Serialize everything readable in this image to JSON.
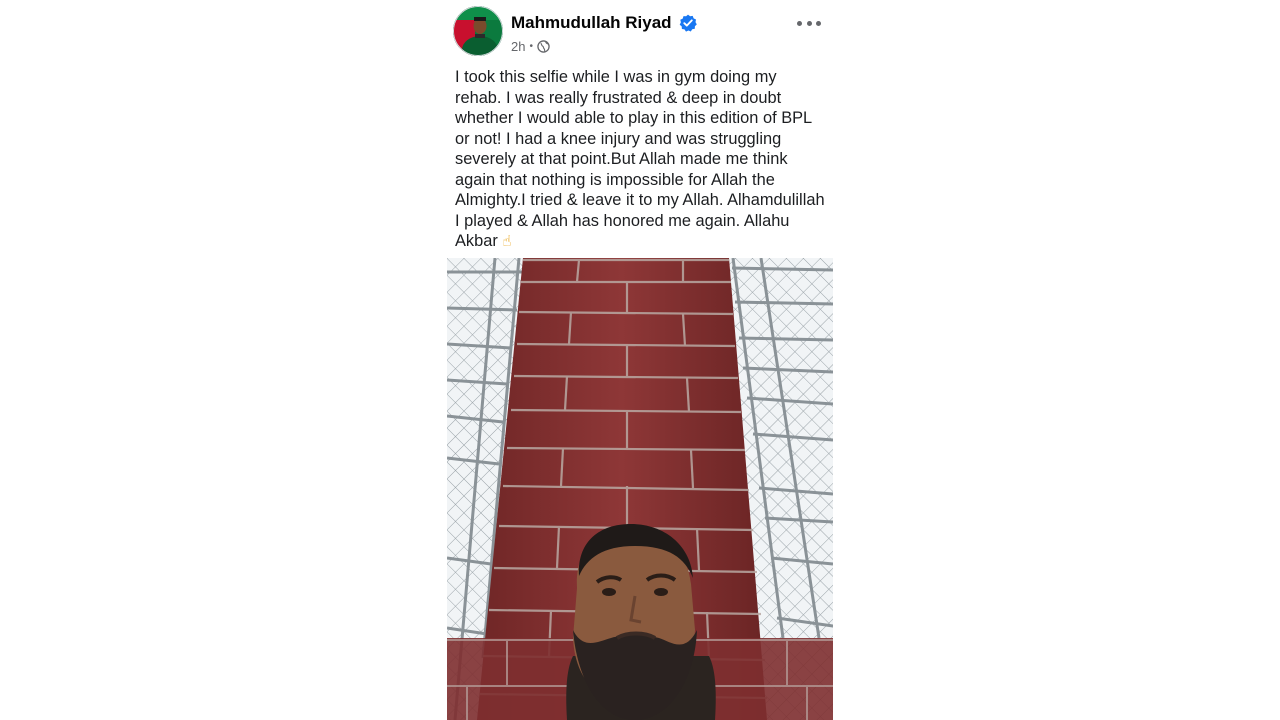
{
  "post": {
    "author": {
      "name": "Mahmudullah Riyad",
      "verified": true,
      "avatar_icon": "profile-photo"
    },
    "meta": {
      "time": "2h",
      "separator": "•",
      "privacy_icon": "globe-icon"
    },
    "menu_icon": "more-horizontal-icon",
    "text": "I took this selfie while I was in gym doing my rehab. I was really frustrated & deep in doubt whether I would able to play in this edition of BPL or not! I had a knee injury and was struggling severely at that point.But Allah made me think again that nothing is impossible for Allah the Almighty.I tried & leave it to my Allah. Alhamdulillah I played & Allah has honored me again. Allahu Akbar",
    "text_emoji": "☝",
    "photo": {
      "description_icon": "selfie-photo"
    }
  },
  "colors": {
    "name": "#050505",
    "meta": "#65676b",
    "verified": "#1877f2",
    "brick": "#8c3535"
  }
}
